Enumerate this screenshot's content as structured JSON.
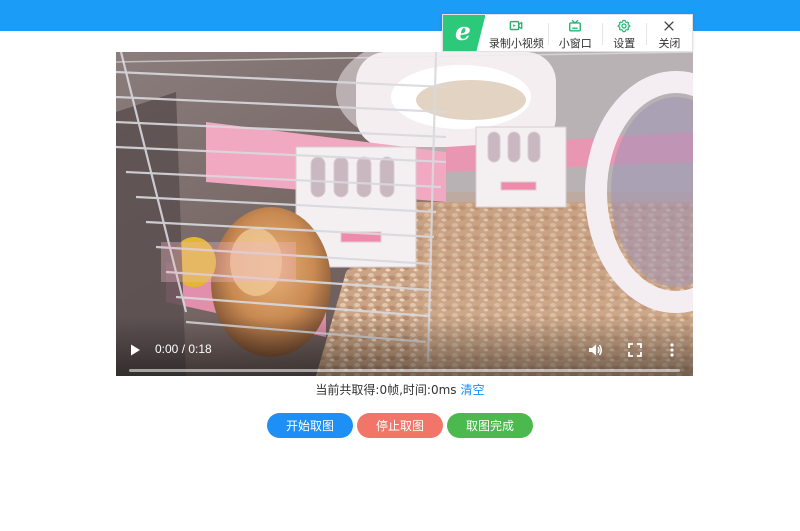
{
  "colors": {
    "top_bar": "#1a9cf7",
    "logo_green": "#2dc97a",
    "icon_green": "#22b573",
    "link_blue": "#1a8ef2",
    "start_button": "#1e90f5",
    "stop_button": "#f2756a",
    "done_button": "#4cb94e"
  },
  "toolbar": {
    "logo_letter": "e",
    "items": [
      {
        "label": "录制小视频",
        "icon": "video-record-icon"
      },
      {
        "label": "小窗口",
        "icon": "tv-icon"
      },
      {
        "label": "设置",
        "icon": "gear-icon"
      },
      {
        "label": "关闭",
        "icon": "close-icon"
      }
    ]
  },
  "video": {
    "time_display": "0:00 / 0:18",
    "current_time": "0:00",
    "duration": "0:18",
    "progress_fraction": 0.0
  },
  "status": {
    "text": "当前共取得:0帧,时间:0ms",
    "clear_link": "清空"
  },
  "buttons": {
    "start": "开始取图",
    "stop": "停止取图",
    "done": "取图完成"
  }
}
